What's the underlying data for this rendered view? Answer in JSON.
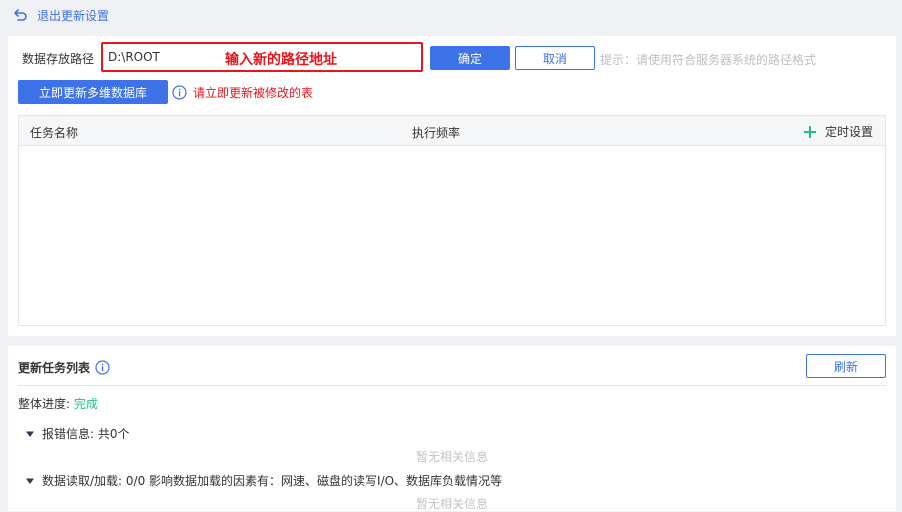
{
  "topbar": {
    "back_label": "退出更新设置"
  },
  "path_row": {
    "label": "数据存放路径",
    "input_value": "D:\\ROOT",
    "annotation": "输入新的路径地址",
    "confirm_label": "确定",
    "cancel_label": "取消",
    "hint": "提示：请使用符合服务器系统的路径格式"
  },
  "update_row": {
    "update_button": "立即更新多维数据库",
    "warning": "请立即更新被修改的表"
  },
  "schedule_table": {
    "columns": [
      "任务名称",
      "执行频率"
    ],
    "timer_label": "定时设置",
    "rows": []
  },
  "task_list": {
    "title": "更新任务列表",
    "refresh_label": "刷新",
    "progress_label": "整体进度:",
    "progress_value": "完成",
    "errors_label": "报错信息: 共0个",
    "errors_empty": "暂无相关信息",
    "io_label": "数据读取/加载: 0/0 影响数据加载的因素有：网速、磁盘的读写I/O、数据库负载情况等",
    "io_empty": "暂无相关信息"
  },
  "colors": {
    "accent": "#3d72e8",
    "error": "#e8161c",
    "success": "#1fbe86",
    "muted": "#c4c4c4"
  },
  "icons": [
    "back-arrow-icon",
    "info-icon",
    "plus-icon",
    "caret-down-icon"
  ]
}
